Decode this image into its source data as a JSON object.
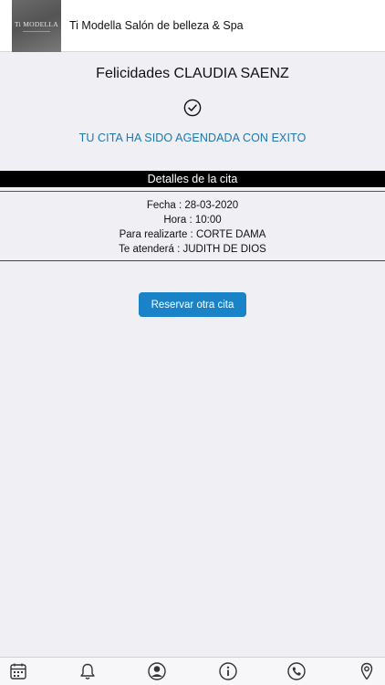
{
  "header": {
    "logo_text": "Ti MODELLA",
    "title": "Ti Modella Salón de belleza & Spa"
  },
  "confirmation": {
    "greeting": "Felicidades CLAUDIA SAENZ",
    "message": "TU CITA HA SIDO AGENDADA CON EXITO",
    "message_color": "#1d77b4"
  },
  "details": {
    "heading": "Detalles de la cita",
    "date_line": "Fecha : 28-03-2020",
    "time_line": "Hora : 10:00",
    "service_line": "Para realizarte : CORTE DAMA",
    "staff_line": "Te atenderá : JUDITH DE DIOS"
  },
  "actions": {
    "book_another": "Reservar otra cita",
    "button_color": "#1a82c7"
  },
  "tabbar": {
    "items": [
      {
        "icon": "calendar-icon"
      },
      {
        "icon": "bell-icon"
      },
      {
        "icon": "profile-icon"
      },
      {
        "icon": "info-icon"
      },
      {
        "icon": "phone-icon"
      },
      {
        "icon": "location-pin-icon"
      }
    ]
  }
}
